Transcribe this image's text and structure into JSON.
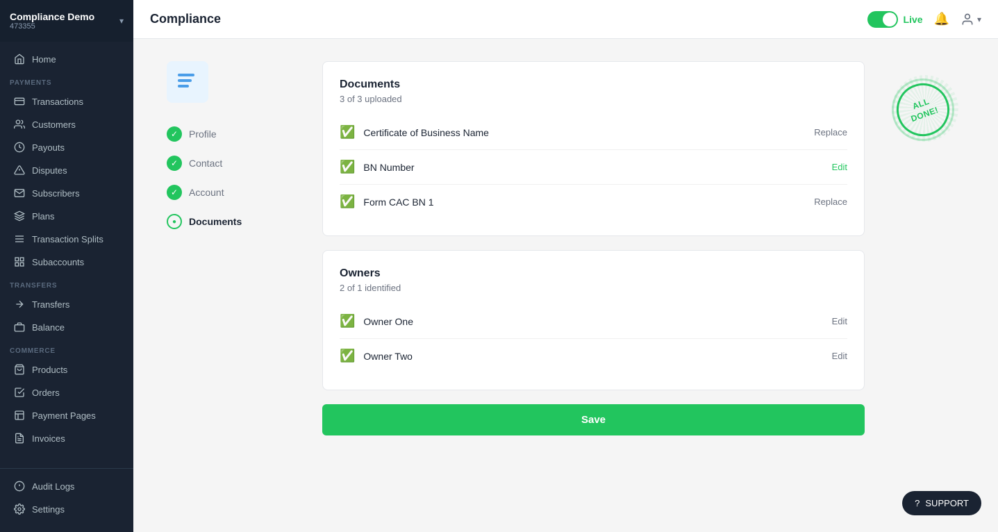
{
  "sidebar": {
    "company": "Compliance Demo",
    "company_id": "473355",
    "sections": [
      {
        "label": null,
        "items": [
          {
            "id": "home",
            "label": "Home",
            "icon": "home"
          }
        ]
      },
      {
        "label": "PAYMENTS",
        "items": [
          {
            "id": "transactions",
            "label": "Transactions",
            "icon": "transactions"
          },
          {
            "id": "customers",
            "label": "Customers",
            "icon": "customers"
          },
          {
            "id": "payouts",
            "label": "Payouts",
            "icon": "payouts"
          },
          {
            "id": "disputes",
            "label": "Disputes",
            "icon": "disputes"
          },
          {
            "id": "subscribers",
            "label": "Subscribers",
            "icon": "subscribers"
          },
          {
            "id": "plans",
            "label": "Plans",
            "icon": "plans"
          },
          {
            "id": "transaction-splits",
            "label": "Transaction Splits",
            "icon": "splits"
          },
          {
            "id": "subaccounts",
            "label": "Subaccounts",
            "icon": "subaccounts"
          }
        ]
      },
      {
        "label": "TRANSFERS",
        "items": [
          {
            "id": "transfers",
            "label": "Transfers",
            "icon": "transfers"
          },
          {
            "id": "balance",
            "label": "Balance",
            "icon": "balance"
          }
        ]
      },
      {
        "label": "COMMERCE",
        "items": [
          {
            "id": "products",
            "label": "Products",
            "icon": "products"
          },
          {
            "id": "orders",
            "label": "Orders",
            "icon": "orders"
          },
          {
            "id": "payment-pages",
            "label": "Payment Pages",
            "icon": "payment-pages"
          },
          {
            "id": "invoices",
            "label": "Invoices",
            "icon": "invoices"
          }
        ]
      }
    ],
    "footer_items": [
      {
        "id": "audit-logs",
        "label": "Audit Logs",
        "icon": "audit"
      },
      {
        "id": "settings",
        "label": "Settings",
        "icon": "settings"
      }
    ]
  },
  "header": {
    "title": "Compliance",
    "live_label": "Live",
    "toggle_state": true
  },
  "steps": {
    "items": [
      {
        "id": "profile",
        "label": "Profile",
        "state": "done"
      },
      {
        "id": "contact",
        "label": "Contact",
        "state": "done"
      },
      {
        "id": "account",
        "label": "Account",
        "state": "done"
      },
      {
        "id": "documents",
        "label": "Documents",
        "state": "current"
      }
    ]
  },
  "documents_card": {
    "title": "Documents",
    "subtitle": "3 of 3 uploaded",
    "rows": [
      {
        "id": "cert-business",
        "name": "Certificate of Business Name",
        "action": "Replace",
        "action_type": "plain"
      },
      {
        "id": "bn-number",
        "name": "BN Number",
        "action": "Edit",
        "action_type": "link"
      },
      {
        "id": "form-cac",
        "name": "Form CAC BN 1",
        "action": "Replace",
        "action_type": "plain"
      }
    ]
  },
  "owners_card": {
    "title": "Owners",
    "subtitle": "2 of 1 identified",
    "rows": [
      {
        "id": "owner-one",
        "name": "Owner One",
        "action": "Edit",
        "action_type": "plain"
      },
      {
        "id": "owner-two",
        "name": "Owner Two",
        "action": "Edit",
        "action_type": "plain"
      }
    ]
  },
  "save_button": {
    "label": "Save"
  },
  "stamp": {
    "line1": "ALL",
    "line2": "DONE!"
  },
  "support_button": {
    "label": "SUPPORT"
  }
}
